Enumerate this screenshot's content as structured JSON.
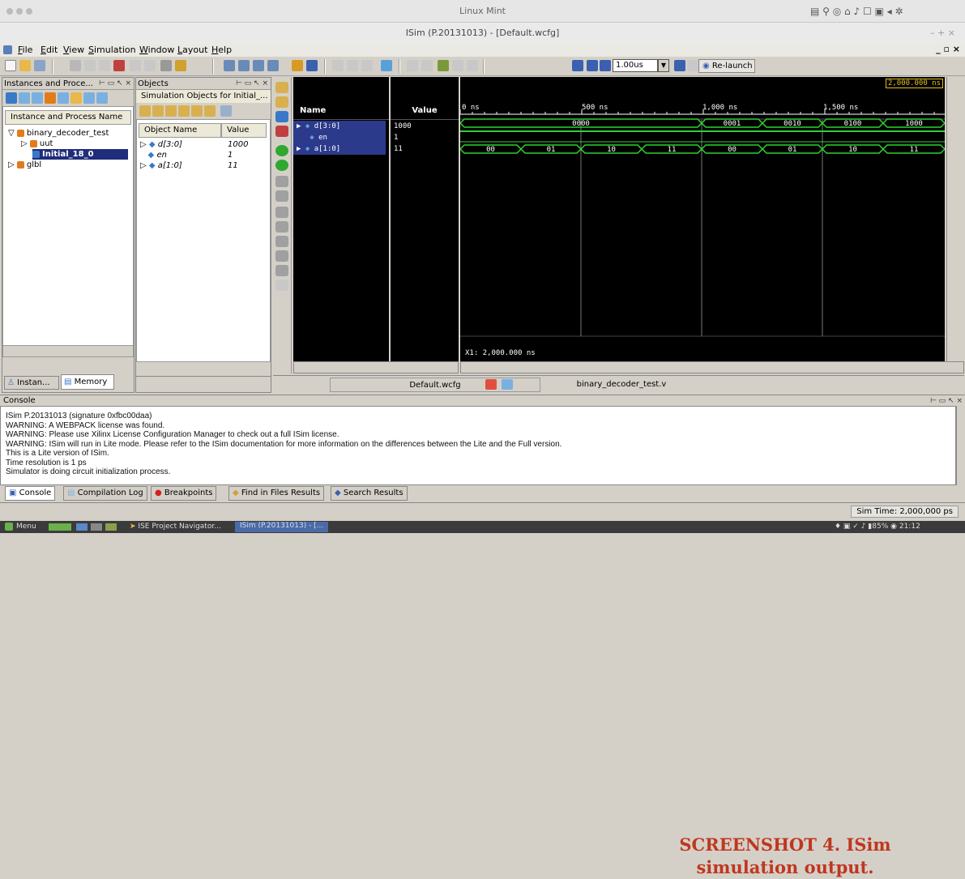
{
  "os": {
    "title": "Linux Mint",
    "clock": "21:12",
    "battery": "85%"
  },
  "window": {
    "title": "ISim (P.20131013) - [Default.wcfg]",
    "controls": "– + ×"
  },
  "menubar": {
    "items": [
      "File",
      "Edit",
      "View",
      "Simulation",
      "Window",
      "Layout",
      "Help"
    ],
    "mdi_controls": "_ ▫ ×"
  },
  "toolbar": {
    "time_value": "1.00us",
    "relaunch_label": "Re-launch"
  },
  "instances_panel": {
    "title": "Instances and Proce...",
    "header": "Instance and Process Name",
    "tree": [
      "binary_decoder_test",
      "uut",
      "Initial_18_0",
      "glbl"
    ],
    "tabs": [
      "Instan...",
      "Memory"
    ]
  },
  "objects_panel": {
    "title": "Objects",
    "subtitle": "Simulation Objects for Initial_...",
    "col_name": "Object Name",
    "col_value": "Value",
    "rows": [
      {
        "name": "d[3:0]",
        "value": "1000"
      },
      {
        "name": "en",
        "value": "1"
      },
      {
        "name": "a[1:0]",
        "value": "11"
      }
    ]
  },
  "wave": {
    "col_name": "Name",
    "col_value": "Value",
    "signals": [
      {
        "name": "d[3:0]",
        "value": "1000"
      },
      {
        "name": "en",
        "value": "1"
      },
      {
        "name": "a[1:0]",
        "value": "11"
      }
    ],
    "top_right_time": "2,000.000 ns",
    "ticks": [
      "0 ns",
      "500 ns",
      "1,000 ns",
      "1,500 ns"
    ],
    "d_labels": [
      "0000",
      "0001",
      "0010",
      "0100",
      "1000"
    ],
    "a_labels": [
      "00",
      "01",
      "10",
      "11",
      "00",
      "01",
      "10",
      "11"
    ],
    "cursor": "X1: 2,000.000 ns",
    "tab_wcfg": "Default.wcfg",
    "tab_src": "binary_decoder_test.v"
  },
  "console": {
    "title": "Console",
    "lines": [
      "ISim P.20131013 (signature 0xfbc00daa)",
      "WARNING: A WEBPACK license was found.",
      "WARNING: Please use Xilinx License Configuration Manager to check out a full ISim license.",
      "WARNING: ISim will run in Lite mode. Please refer to the ISim documentation for more information on the differences between the Lite and the Full version.",
      "This is a Lite version of ISim.",
      "Time resolution is 1 ps",
      "Simulator is doing circuit initialization process."
    ],
    "caption_line1": "SCREENSHOT 4. ISim",
    "caption_line2": "simulation output.",
    "tabs": [
      "Console",
      "Compilation Log",
      "Breakpoints",
      "Find in Files Results",
      "Search Results"
    ],
    "sim_time": "Sim Time: 2,000,000 ps"
  },
  "taskbar": {
    "menu": "Menu",
    "apps": [
      "ISE Project Navigator...",
      "ISim (P.20131013) - [..."
    ]
  },
  "colors": {
    "wave_green": "#2fd12f",
    "selected_row": "#2c3a8c",
    "caption_red": "#c0371f"
  }
}
